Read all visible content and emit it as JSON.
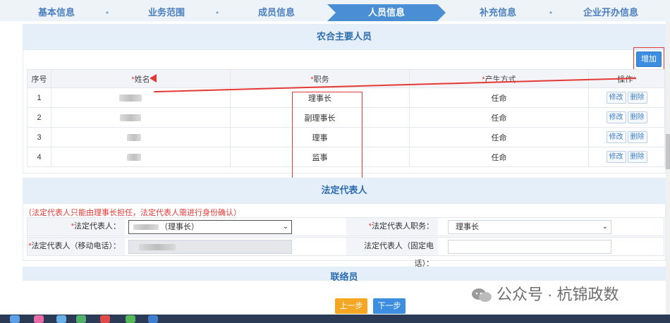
{
  "steps": [
    {
      "label": "基本信息"
    },
    {
      "label": "业务范围"
    },
    {
      "label": "成员信息"
    },
    {
      "label": "人员信息"
    },
    {
      "label": "补充信息"
    },
    {
      "label": "企业开办信息"
    }
  ],
  "step_separator": "•",
  "main_personnel": {
    "title": "农合主要人员",
    "add_label": "增加",
    "columns": [
      "序号",
      "姓名",
      "职务",
      "产生方式",
      "操作"
    ],
    "required_mark": "*",
    "rows": [
      {
        "no": "1",
        "position": "理事长",
        "method": "任命"
      },
      {
        "no": "2",
        "position": "副理事长",
        "method": "任命"
      },
      {
        "no": "3",
        "position": "理事",
        "method": "任命"
      },
      {
        "no": "4",
        "position": "监事",
        "method": "任命"
      }
    ],
    "edit_label": "修改",
    "delete_label": "删除"
  },
  "legal_rep": {
    "title": "法定代表人",
    "notice": "（法定代表人只能由理事长担任，法定代表人需进行身份确认）",
    "rep_label": "法定代表人：",
    "rep_value": "（理事长）",
    "duty_label": "法定代表人职务：",
    "duty_value": "理事长",
    "mobile_label": "法定代表人（移动电话）：",
    "landline_label": "法定代表人（固定电话）："
  },
  "contact": {
    "title": "联络员"
  },
  "footer": {
    "prev_label": "上一步",
    "next_label": "下一步"
  },
  "watermark": {
    "text": "公众号 · 杭锦政数"
  },
  "colors": {
    "accent": "#3d8ee0",
    "annotation": "#e53935",
    "prev_button": "#f5a623"
  }
}
